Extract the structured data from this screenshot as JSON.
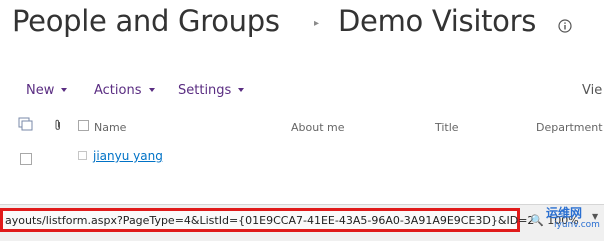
{
  "header": {
    "breadcrumb_root": "People and Groups",
    "breadcrumb_separator": "▸",
    "page_title": "Demo Visitors",
    "info_icon": "info-icon"
  },
  "toolbar": {
    "new_label": "New",
    "actions_label": "Actions",
    "settings_label": "Settings",
    "view_label": "Vie"
  },
  "list": {
    "columns": [
      "Name",
      "About me",
      "Title",
      "Department"
    ],
    "rows": [
      {
        "name": "jianyu yang"
      }
    ]
  },
  "status_bar": {
    "url": "ayouts/listform.aspx?PageType=4&ListId={01E9CCA7-41EE-43A5-96A0-3A91A9E9CE3D}&ID=2",
    "zoom": "100%"
  },
  "watermark": {
    "cn": "运维网",
    "domain": "iyunv.com"
  },
  "colors": {
    "accent": "#5a2d82",
    "link": "#0072c6",
    "highlight_border": "#e01b1b"
  }
}
